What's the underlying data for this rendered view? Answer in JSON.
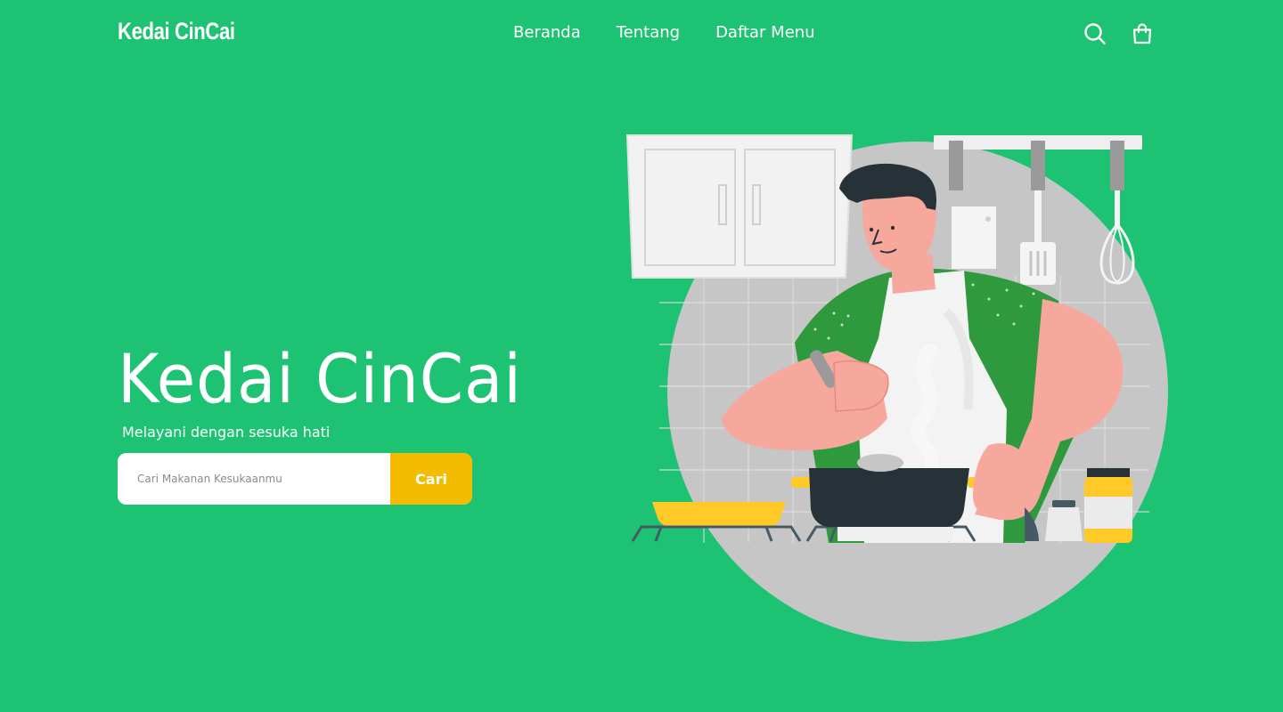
{
  "header": {
    "brand": "Kedai CinCai",
    "nav": [
      {
        "label": "Beranda"
      },
      {
        "label": "Tentang"
      },
      {
        "label": "Daftar Menu"
      }
    ],
    "icons": [
      "search-icon",
      "shopping-bag-icon"
    ]
  },
  "hero": {
    "title": "Kedai CinCai",
    "subtitle": "Melayani dengan sesuka hati",
    "search": {
      "placeholder": "Cari Makanan Kesukaanmu",
      "value": "",
      "button_label": "Cari"
    },
    "illustration": "chef-cooking-illustration"
  },
  "colors": {
    "background": "#1dc373",
    "accent": "#f4bb00",
    "text": "#ffffff"
  }
}
